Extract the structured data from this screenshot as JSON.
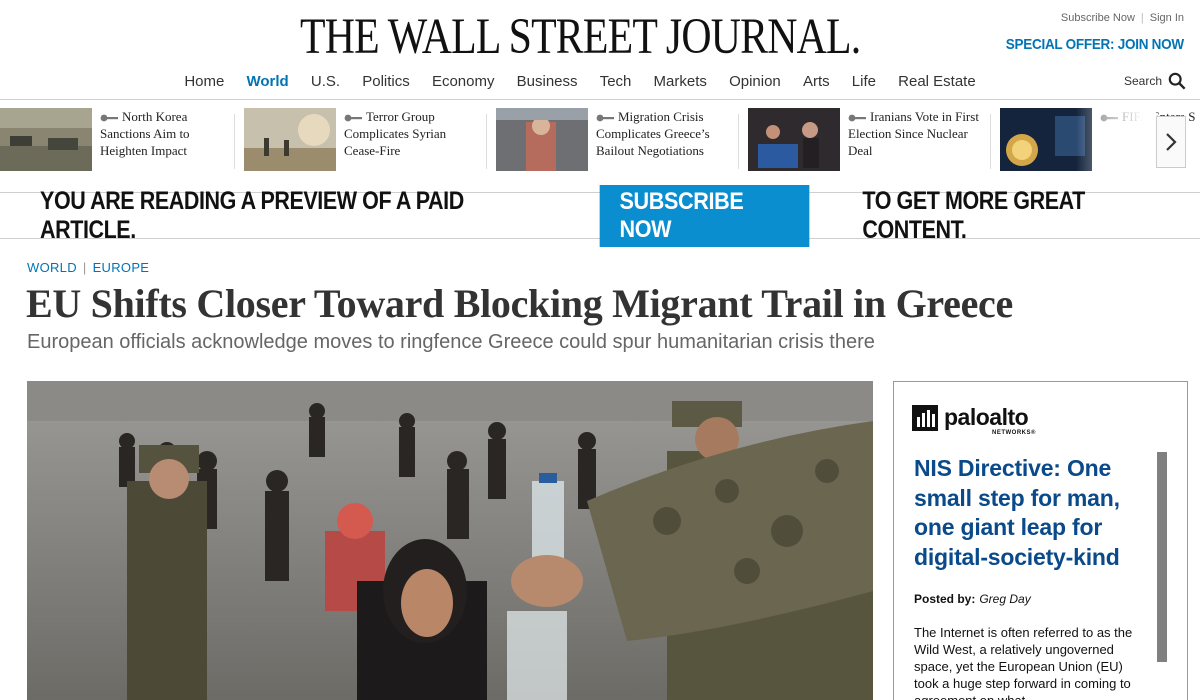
{
  "masthead": {
    "logo": "THE WALL STREET JOURNAL.",
    "subscribe_now": "Subscribe Now",
    "sign_in": "Sign In",
    "special_offer": "SPECIAL OFFER: JOIN NOW",
    "search_label": "Search"
  },
  "nav": {
    "items": [
      "Home",
      "World",
      "U.S.",
      "Politics",
      "Economy",
      "Business",
      "Tech",
      "Markets",
      "Opinion",
      "Arts",
      "Life",
      "Real Estate"
    ],
    "active": "World"
  },
  "carousel": {
    "stories": [
      {
        "title": "North Korea Sanctions Aim to Heighten Impact"
      },
      {
        "title": "Terror Group Complicates Syrian Cease-Fire"
      },
      {
        "title": "Migration Crisis Complicates Greece’s Bailout Negotiations"
      },
      {
        "title": "Iranians Vote in First Election Since Nuclear Deal"
      },
      {
        "title": "FIFA Enters S"
      }
    ]
  },
  "paywall": {
    "lead": "YOU ARE READING A PREVIEW OF A PAID ARTICLE.",
    "button": "SUBSCRIBE NOW",
    "tail": "TO GET MORE GREAT CONTENT."
  },
  "article": {
    "section": "WORLD",
    "subsection": "EUROPE",
    "headline": "EU Shifts Closer Toward Blocking Migrant Trail in Greece",
    "dek": "European officials acknowledge moves to ringfence Greece could spur humanitarian crisis there"
  },
  "ad": {
    "brand": "paloalto",
    "brand_sub": "NETWORKS®",
    "title": "NIS Directive: One small step for man, one giant leap for digital-society-kind",
    "posted_label": "Posted by:",
    "posted_author": "Greg Day",
    "body": "The Internet is often referred to as the Wild West, a relatively ungoverned space, yet the European Union (EU) took a huge step forward in coming to agreement on what"
  },
  "colors": {
    "accent_blue": "#0274b6",
    "subscribe_button": "#0a8ed0",
    "ad_title": "#0a4a8a"
  }
}
